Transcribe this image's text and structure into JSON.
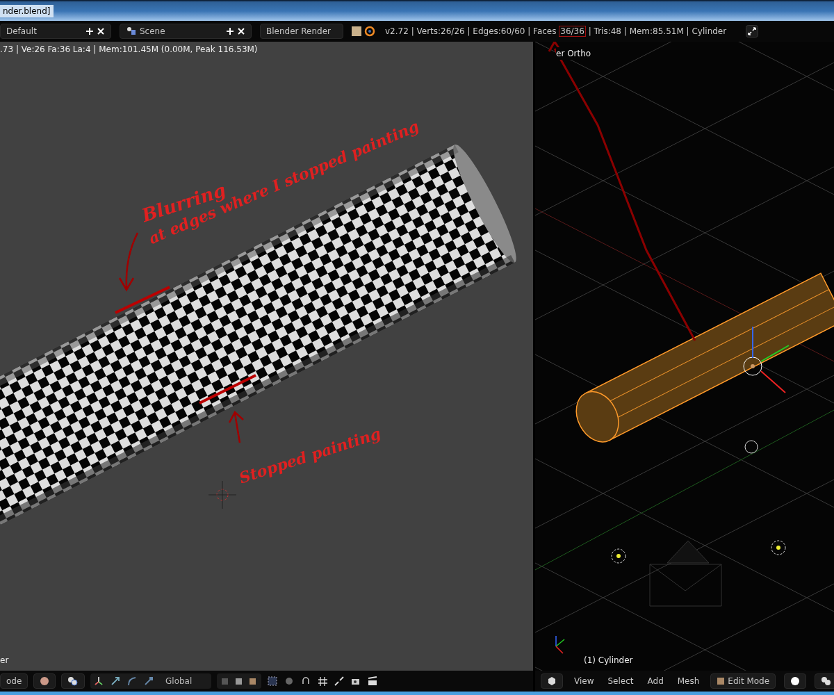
{
  "window": {
    "title": "nder.blend]"
  },
  "info_header": {
    "screen_layout": "Default",
    "scene": "Scene",
    "render_engine": "Blender Render",
    "stats_prefix": "v2.72 | Verts:26/26 | Edges:60/60 | Faces ",
    "stats_highlighted": "36/36",
    "stats_suffix": " | Tris:48 | Mem:85.51M | Cylinder"
  },
  "image_editor": {
    "info": ".73 | Ve:26 Fa:36 La:4 | Mem:101.45M (0.00M, Peak 116.53M)",
    "corner_label": "er",
    "annotations": [
      {
        "text": "Blurring"
      },
      {
        "text": "at edges where I stopped painting"
      },
      {
        "text": "Stopped painting"
      }
    ],
    "header": {
      "mode": "ode",
      "orientation": "Global"
    }
  },
  "viewport": {
    "view_label": "er Ortho",
    "object_label": "(1) Cylinder",
    "menus": [
      "View",
      "Select",
      "Add",
      "Mesh"
    ],
    "mode": "Edit Mode"
  }
}
